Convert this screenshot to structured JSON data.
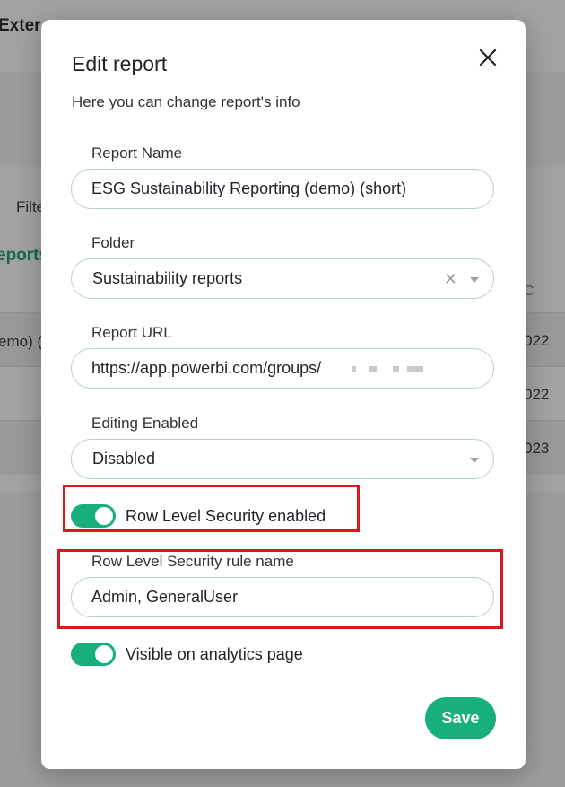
{
  "background": {
    "title": "Exter",
    "filter_label": "Filte",
    "reports_label": "eports",
    "rows": [
      {
        "left": "emo) (",
        "right": "022"
      },
      {
        "left": "",
        "right": "022"
      },
      {
        "left": "",
        "right": "023"
      }
    ],
    "column_header": "C"
  },
  "modal": {
    "title": "Edit report",
    "subtitle": "Here you can change report's info",
    "close_icon": "close-icon",
    "fields": {
      "report_name": {
        "label": "Report Name",
        "value": "ESG Sustainability Reporting (demo) (short)"
      },
      "folder": {
        "label": "Folder",
        "value": "Sustainability reports"
      },
      "report_url": {
        "label": "Report URL",
        "value": "https://app.powerbi.com/groups/"
      },
      "editing": {
        "label": "Editing Enabled",
        "value": "Disabled"
      },
      "rls_rule": {
        "label": "Row Level Security rule name",
        "value": "Admin, GeneralUser"
      }
    },
    "toggles": {
      "rls": {
        "label": "Row Level Security enabled",
        "on": true
      },
      "visible": {
        "label": "Visible on analytics page",
        "on": true
      }
    },
    "save_label": "Save"
  },
  "colors": {
    "accent": "#17b07a",
    "highlight": "#d7191c"
  }
}
